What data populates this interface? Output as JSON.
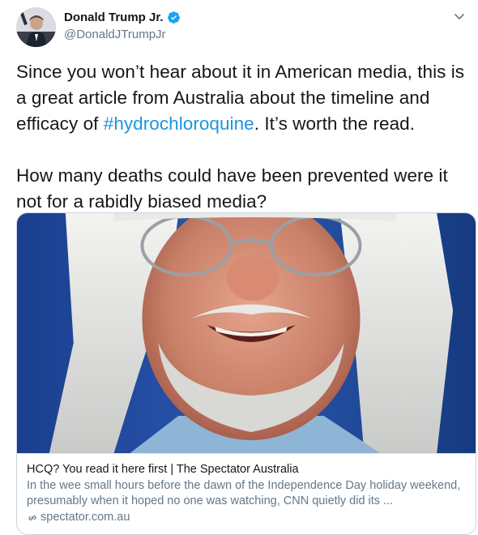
{
  "author": {
    "display_name": "Donald Trump Jr.",
    "handle": "@DonaldJTrumpJr",
    "verified": true,
    "verified_color": "#1da1f2"
  },
  "tweet": {
    "line1_before": "Since you won’t hear about it in American media, this is a great article from Australia about the timeline and efficacy of ",
    "hashtag": "#hydrochloroquine",
    "line1_after": ". It’s worth the read.",
    "paragraph2": "How many deaths could have been prevented were it not for a rabidly biased media?",
    "hashtag_color": "#1b95e0"
  },
  "card": {
    "title": "HCQ? You read it here first | The Spectator Australia",
    "description": "In the wee small hours before the dawn of the Independence Day holiday weekend, presumably when it hoped no one was watching, CNN quietly did its ...",
    "domain": "spectator.com.au",
    "image_icon": "portrait-photo"
  }
}
